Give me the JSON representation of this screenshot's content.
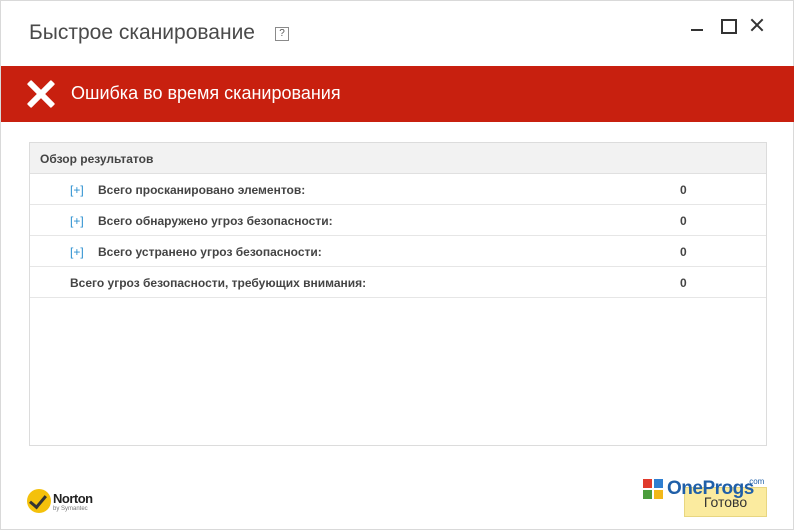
{
  "window": {
    "title": "Быстрое сканирование",
    "help_label": "?"
  },
  "banner": {
    "text": "Ошибка во время сканирования",
    "color": "#c8200f"
  },
  "results": {
    "header": "Обзор результатов",
    "rows": [
      {
        "expand": "[+]",
        "label": "Всего просканировано элементов:",
        "value": "0"
      },
      {
        "expand": "[+]",
        "label": "Всего обнаружено угроз безопасности:",
        "value": "0"
      },
      {
        "expand": "[+]",
        "label": "Всего устранено угроз безопасности:",
        "value": "0"
      },
      {
        "label": "Всего угроз безопасности, требующих внимания:",
        "value": "0"
      }
    ]
  },
  "footer": {
    "brand_name": "Norton",
    "brand_sub": "by Symantec",
    "done_label": "Готово",
    "done_color": "#fbeb9f"
  },
  "watermark": {
    "text": "OneProgs",
    "suffix": ".com"
  }
}
